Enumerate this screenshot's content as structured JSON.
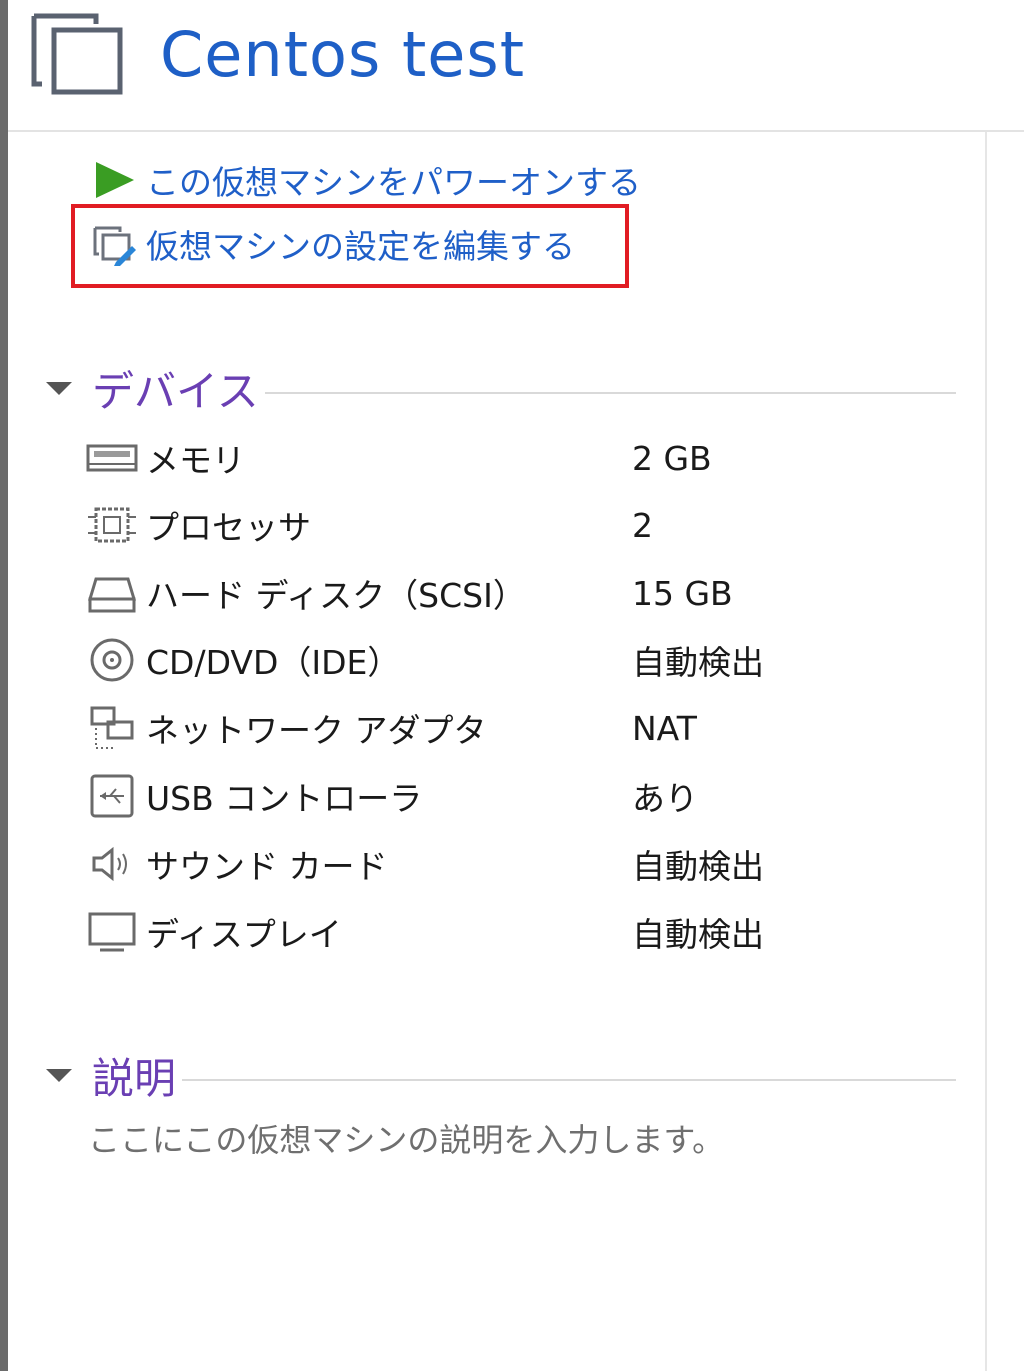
{
  "header": {
    "title": "Centos test",
    "icon": "vm-window-icon"
  },
  "actions": {
    "power_on": {
      "label": "この仮想マシンをパワーオンする",
      "icon": "play-icon",
      "color": "#3a9d23"
    },
    "edit_settings": {
      "label": "仮想マシンの設定を編集する",
      "icon": "edit-settings-icon",
      "highlighted": true,
      "highlight_color": "#e11c23"
    }
  },
  "devices": {
    "title": "デバイス",
    "items": [
      {
        "name": "メモリ",
        "value": "2 GB",
        "icon": "memory-icon"
      },
      {
        "name": "プロセッサ",
        "value": "2",
        "icon": "processor-icon"
      },
      {
        "name": "ハード ディスク（SCSI）",
        "value": "15 GB",
        "icon": "hard-disk-icon"
      },
      {
        "name": "CD/DVD（IDE）",
        "value": "自動検出",
        "icon": "cd-dvd-icon"
      },
      {
        "name": "ネットワーク アダプタ",
        "value": "NAT",
        "icon": "network-adapter-icon"
      },
      {
        "name": "USB コントローラ",
        "value": "あり",
        "icon": "usb-icon"
      },
      {
        "name": "サウンド カード",
        "value": "自動検出",
        "icon": "speaker-icon"
      },
      {
        "name": "ディスプレイ",
        "value": "自動検出",
        "icon": "display-icon"
      }
    ]
  },
  "description": {
    "title": "説明",
    "placeholder": "ここにこの仮想マシンの説明を入力します。"
  },
  "colors": {
    "link": "#1f5fc8",
    "section_title": "#6a3fb3",
    "title": "#1e5fc6"
  }
}
